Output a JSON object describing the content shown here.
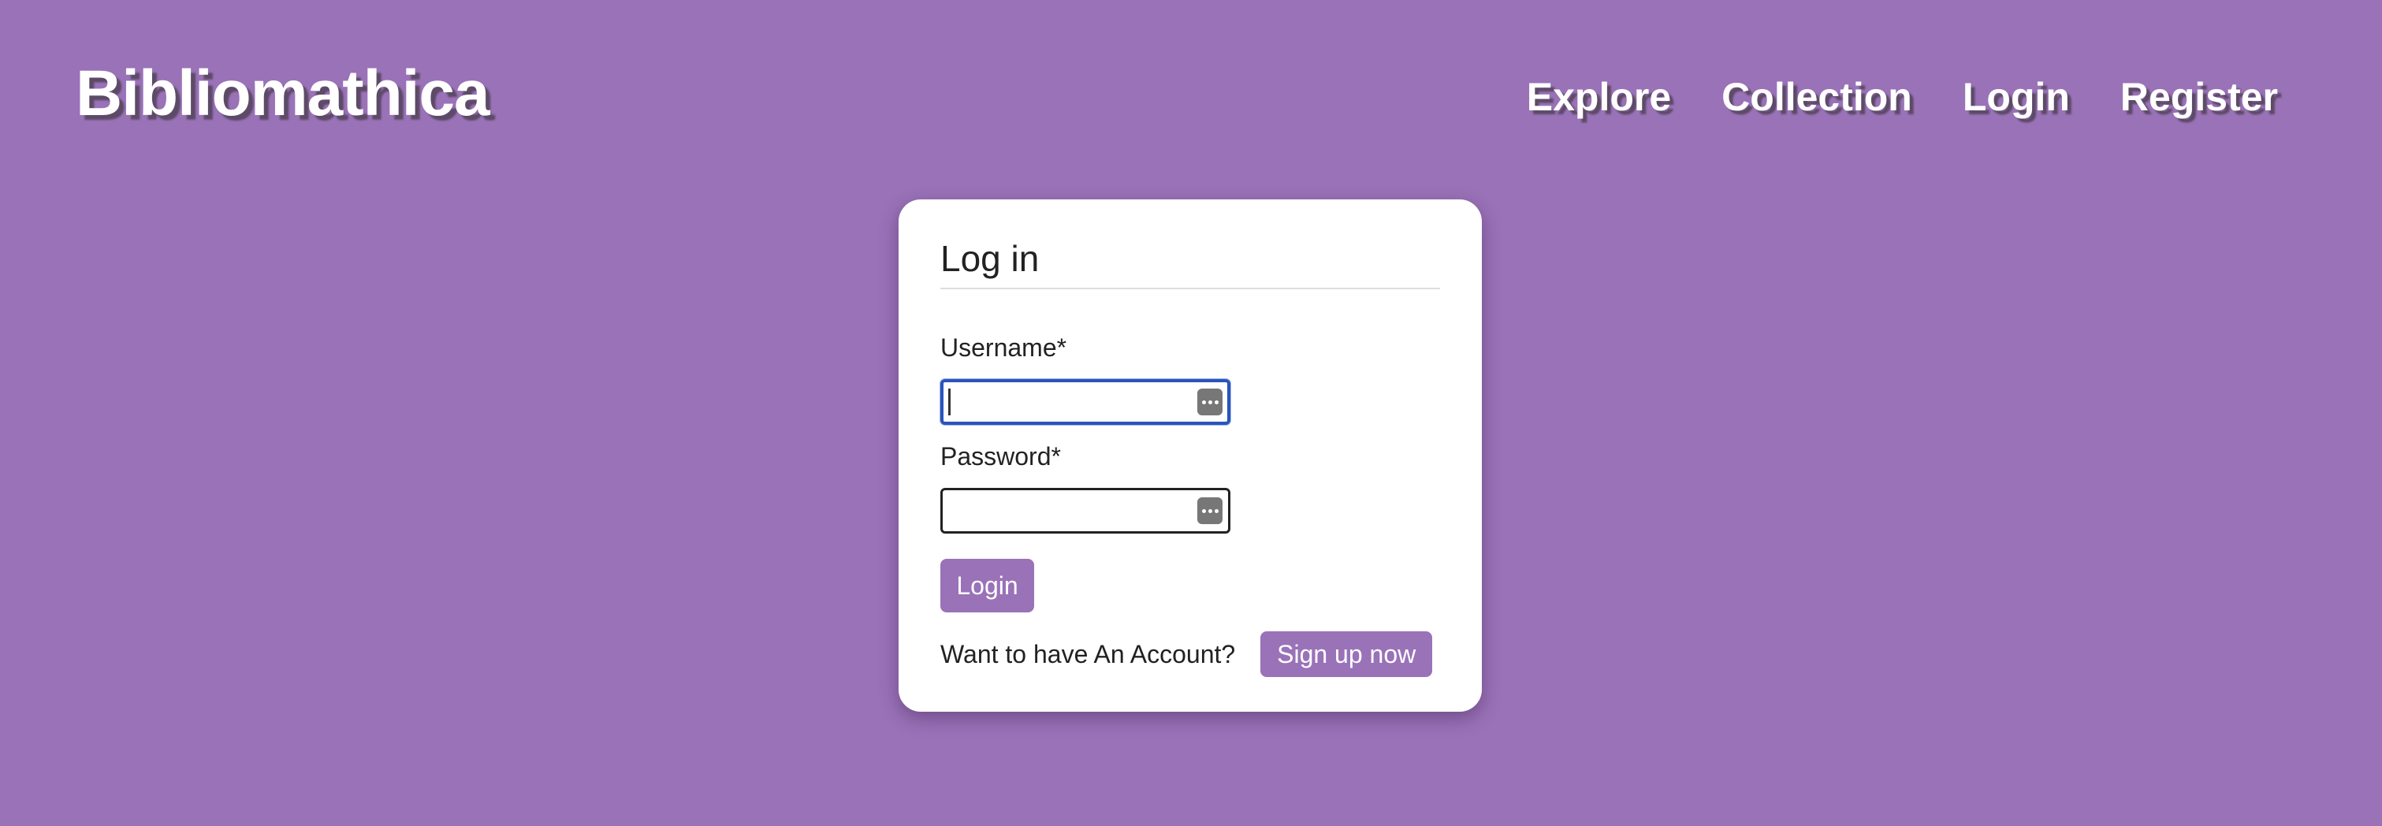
{
  "header": {
    "brand": "Bibliomathica",
    "nav": [
      "Explore",
      "Collection",
      "Login",
      "Register"
    ]
  },
  "login_card": {
    "title": "Log in",
    "username_label": "Username*",
    "username_value": "",
    "password_label": "Password*",
    "password_value": "",
    "password_manager_icon": "ellipsis-icon",
    "login_button": "Login",
    "signup_prompt": "Want to have An Account?",
    "signup_button": "Sign up now"
  },
  "colors": {
    "background": "#9a72b8",
    "accent": "#9a72b8",
    "card": "#ffffff",
    "focus_ring": "#2a55b8"
  }
}
